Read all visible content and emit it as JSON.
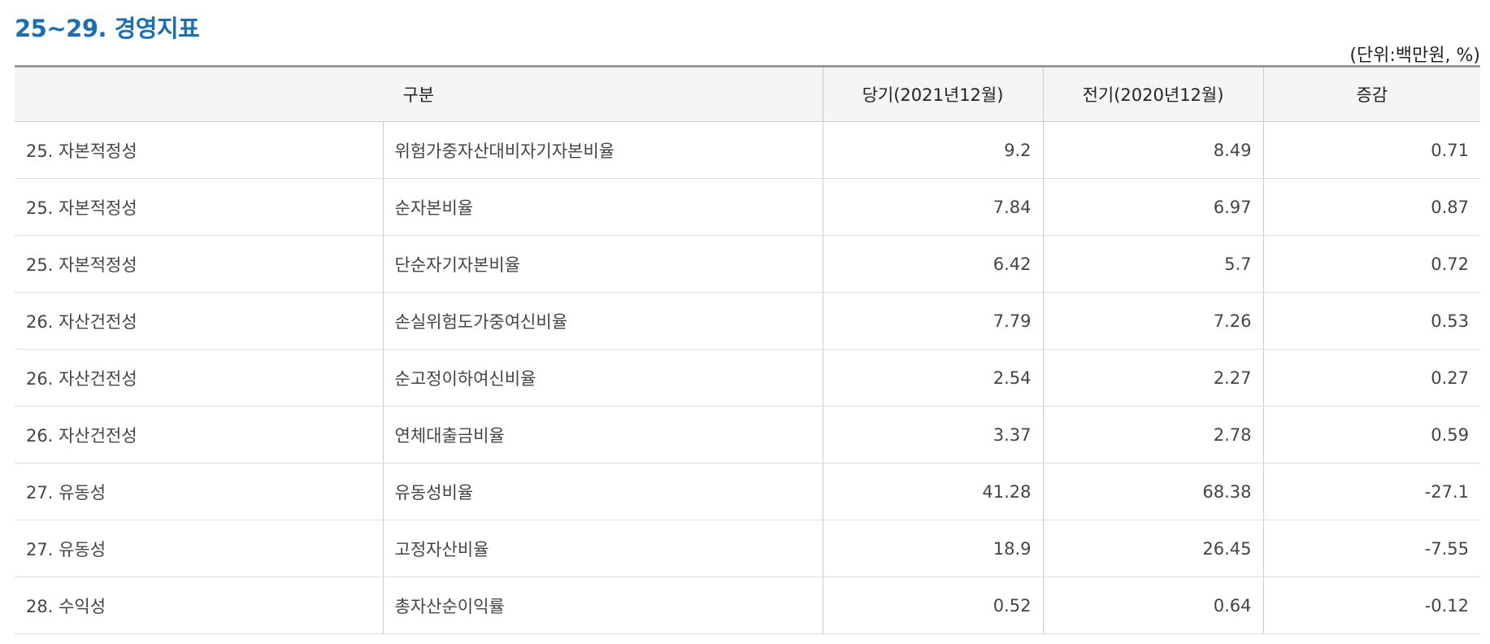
{
  "title": "25~29. 경영지표",
  "unit": "(단위:백만원, %)",
  "table": {
    "headers": {
      "category": "구분",
      "current": "당기(2021년12월)",
      "previous": "전기(2020년12월)",
      "change": "증감"
    },
    "rows": [
      {
        "group": "25. 자본적정성",
        "item": "위험가중자산대비자기자본비율",
        "current": "9.2",
        "previous": "8.49",
        "change": "0.71"
      },
      {
        "group": "25. 자본적정성",
        "item": "순자본비율",
        "current": "7.84",
        "previous": "6.97",
        "change": "0.87"
      },
      {
        "group": "25. 자본적정성",
        "item": "단순자기자본비율",
        "current": "6.42",
        "previous": "5.7",
        "change": "0.72"
      },
      {
        "group": "26. 자산건전성",
        "item": "손실위험도가중여신비율",
        "current": "7.79",
        "previous": "7.26",
        "change": "0.53"
      },
      {
        "group": "26. 자산건전성",
        "item": "순고정이하여신비율",
        "current": "2.54",
        "previous": "2.27",
        "change": "0.27"
      },
      {
        "group": "26. 자산건전성",
        "item": "연체대출금비율",
        "current": "3.37",
        "previous": "2.78",
        "change": "0.59"
      },
      {
        "group": "27. 유동성",
        "item": "유동성비율",
        "current": "41.28",
        "previous": "68.38",
        "change": "-27.1"
      },
      {
        "group": "27. 유동성",
        "item": "고정자산비율",
        "current": "18.9",
        "previous": "26.45",
        "change": "-7.55"
      },
      {
        "group": "28. 수익성",
        "item": "총자산순이익률",
        "current": "0.52",
        "previous": "0.64",
        "change": "-0.12"
      }
    ]
  }
}
